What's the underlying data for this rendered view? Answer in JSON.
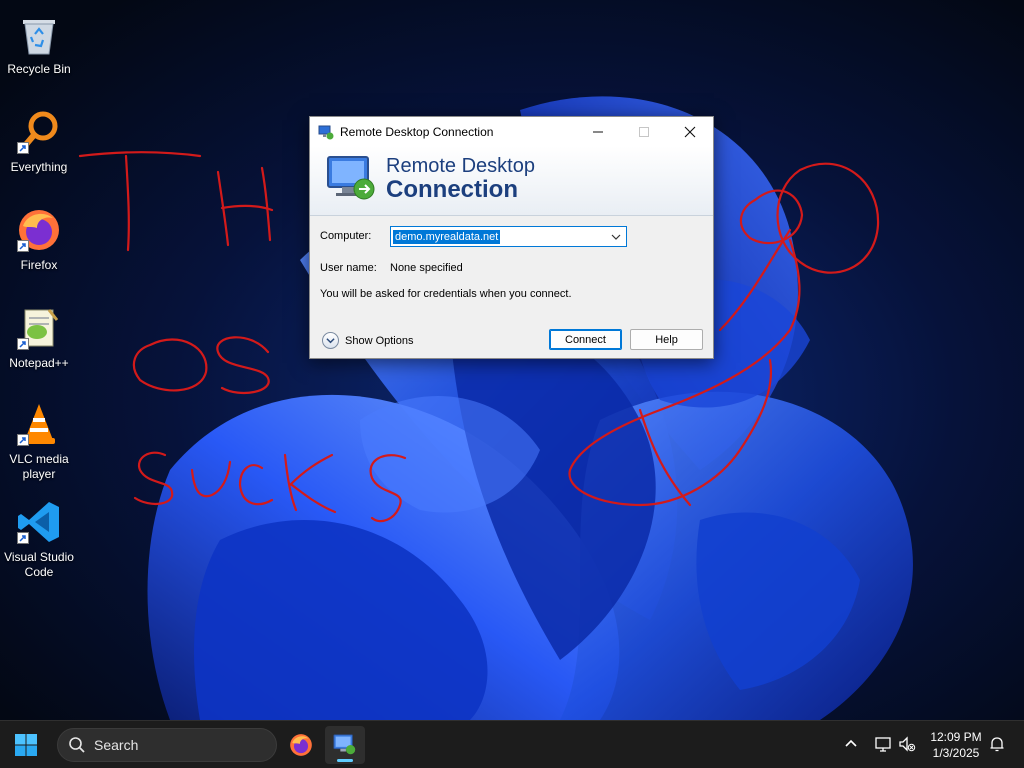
{
  "desktop": {
    "icons": [
      {
        "label": "Recycle Bin",
        "icon": "recycle-bin-icon",
        "shortcut": false
      },
      {
        "label": "Everything",
        "icon": "everything-search-icon",
        "shortcut": true
      },
      {
        "label": "Firefox",
        "icon": "firefox-icon",
        "shortcut": true
      },
      {
        "label": "Notepad++",
        "icon": "notepad-plus-plus-icon",
        "shortcut": true
      },
      {
        "label": "VLC media player",
        "icon": "vlc-icon",
        "shortcut": true
      },
      {
        "label": "Visual Studio Code",
        "icon": "vscode-icon",
        "shortcut": true
      }
    ]
  },
  "rdc": {
    "title": "Remote Desktop Connection",
    "banner_line1": "Remote Desktop",
    "banner_line2": "Connection",
    "computer_label": "Computer:",
    "computer_value": "demo.myrealdata.net",
    "username_label": "User name:",
    "username_value": "None specified",
    "notice": "You will be asked for credentials when you connect.",
    "show_options": "Show Options",
    "connect": "Connect",
    "help": "Help"
  },
  "taskbar": {
    "search_placeholder": "Search",
    "time": "12:09 PM",
    "date": "1/3/2025"
  },
  "colors": {
    "accent": "#0078d7",
    "banner_text": "#1c3f7e",
    "scribble": "#d31a1a",
    "taskbar_bg": "#1c1c1c"
  }
}
